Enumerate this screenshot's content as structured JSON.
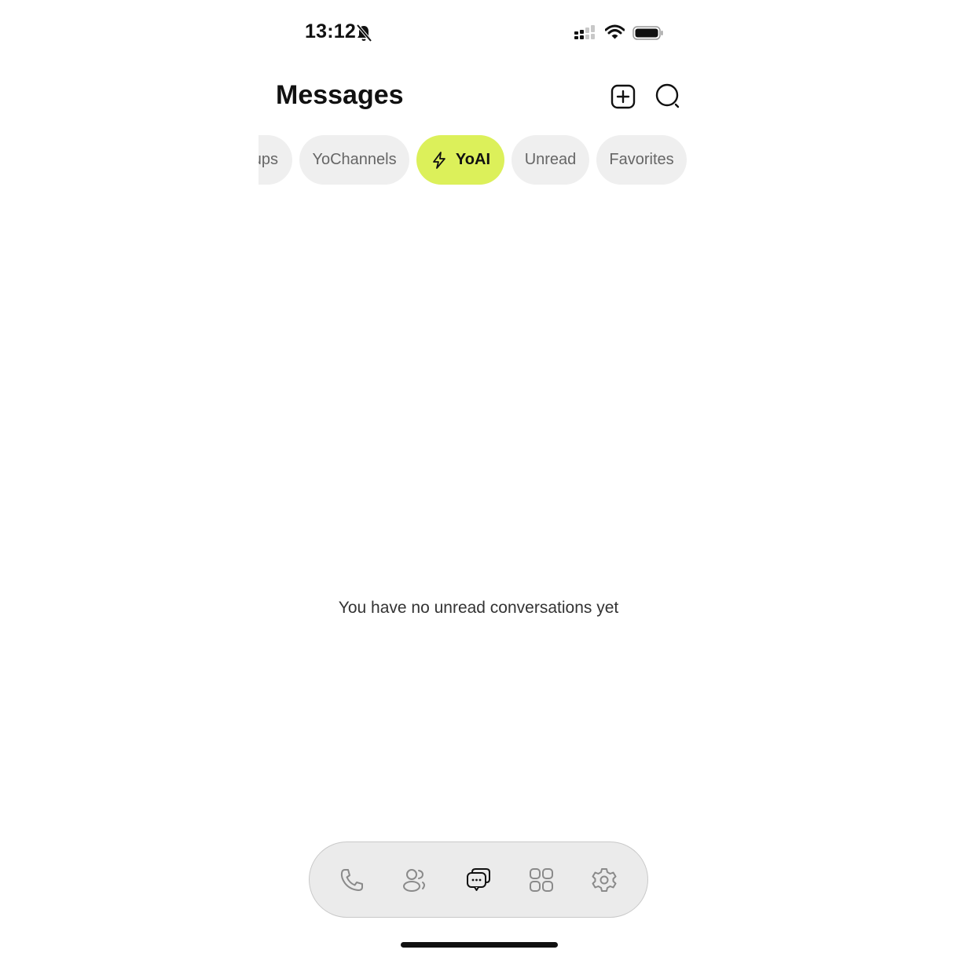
{
  "status_bar": {
    "time": "13:12",
    "icons": [
      "bell-muted-icon",
      "signal-icon",
      "wifi-icon",
      "battery-icon"
    ]
  },
  "header": {
    "title": "Messages",
    "actions": [
      {
        "name": "new-message",
        "icon": "plus-square-icon"
      },
      {
        "name": "search",
        "icon": "search-icon"
      }
    ]
  },
  "filter_tabs": [
    {
      "label": "Groups",
      "visible_text": "ups",
      "active": false
    },
    {
      "label": "YoChannels",
      "active": false
    },
    {
      "label": "YoAI",
      "icon": "lightning-icon",
      "active": true
    },
    {
      "label": "Unread",
      "active": false
    },
    {
      "label": "Favorites",
      "active": false
    }
  ],
  "empty_state": {
    "text": "You have no unread conversations yet"
  },
  "bottom_nav": [
    {
      "name": "calls",
      "icon": "phone-icon",
      "active": false
    },
    {
      "name": "contacts",
      "icon": "contacts-icon",
      "active": false
    },
    {
      "name": "messages",
      "icon": "chat-bubbles-icon",
      "active": true
    },
    {
      "name": "apps",
      "icon": "grid-icon",
      "active": false
    },
    {
      "name": "settings",
      "icon": "gear-icon",
      "active": false
    }
  ],
  "colors": {
    "accent": "#dcf05a",
    "chip_bg": "#efefef",
    "nav_bg": "#ebebeb",
    "inactive_icon": "#8a8a8a",
    "active_icon": "#111111"
  }
}
